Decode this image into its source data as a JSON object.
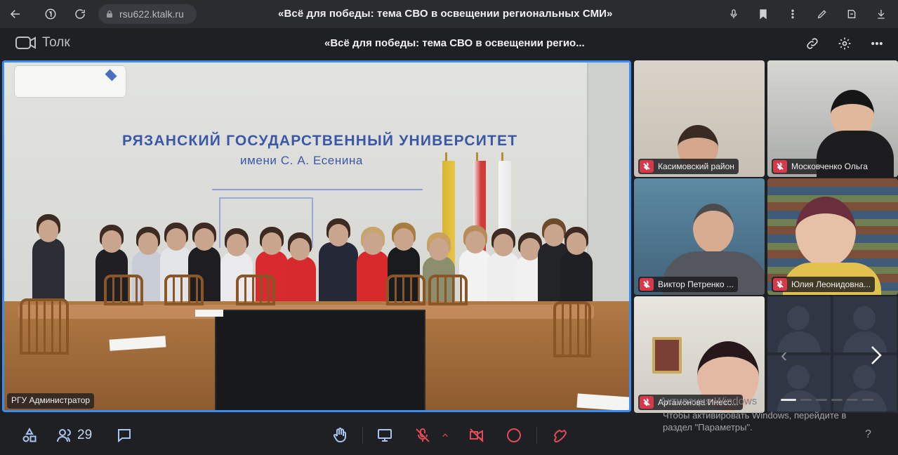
{
  "browser": {
    "url": "rsu622.ktalk.ru",
    "tab_title": "«Всё для победы: тема СВО в освещении региональных СМИ»"
  },
  "app": {
    "logo_text": "Толк",
    "meeting_title": "«Всё для победы: тема СВО в освещении регио..."
  },
  "main_video": {
    "label": "РГУ Администратор",
    "wall_text_line1": "РЯЗАНСКИЙ ГОСУДАРСТВЕННЫЙ УНИВЕРСИТЕТ",
    "wall_text_line2": "имени С. А. Есенина"
  },
  "participants": [
    {
      "name": "Касимовский район",
      "muted": true
    },
    {
      "name": "Московченко Ольга",
      "muted": true
    },
    {
      "name": "Виктор Петренко ...",
      "muted": true
    },
    {
      "name": "Юлия Леонидовна...",
      "muted": true
    },
    {
      "name": "Артамонова Инесс...",
      "muted": true
    }
  ],
  "watermark": {
    "heading": "Активация Windows",
    "line1": "Чтобы активировать Windows, перейдите в",
    "line2": "раздел \"Параметры\"."
  },
  "toolbar": {
    "participant_count": "29",
    "help": "?"
  },
  "colors": {
    "active_speaker_border": "#3b8cf0",
    "muted_badge": "#d8394a",
    "end_call": "#e24a5a"
  }
}
